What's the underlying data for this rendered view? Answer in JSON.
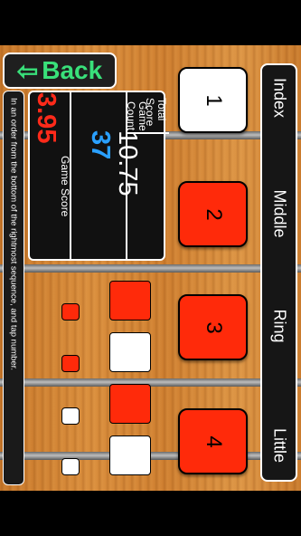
{
  "back_button": {
    "label": "Back",
    "arrow": "⇦"
  },
  "hint_text": "In an order from the bottom of the rightmost sequence, and tap number.",
  "score": {
    "total_score_label": "Total Score",
    "total_score_value": "37",
    "game_count_label": "Game Count",
    "game_count_value": "10.75",
    "game_score_label": "Game Score",
    "game_score_value": "3.95"
  },
  "fingers": [
    "Index",
    "Middle",
    "Ring",
    "Little"
  ],
  "keys": [
    {
      "number": "1",
      "state": "white"
    },
    {
      "number": "2",
      "state": "red"
    },
    {
      "number": "3",
      "state": "red"
    },
    {
      "number": "4",
      "state": "red"
    }
  ],
  "sequence_large": [
    "red",
    "white",
    "red",
    "white"
  ],
  "sequence_small": [
    "red",
    "red",
    "white",
    "white"
  ],
  "colors": {
    "red": "#ff2a0a",
    "white": "#ffffff",
    "score_blue": "#2aa0ff",
    "score_red": "#ff2a1a",
    "back_green": "#39e07a"
  }
}
